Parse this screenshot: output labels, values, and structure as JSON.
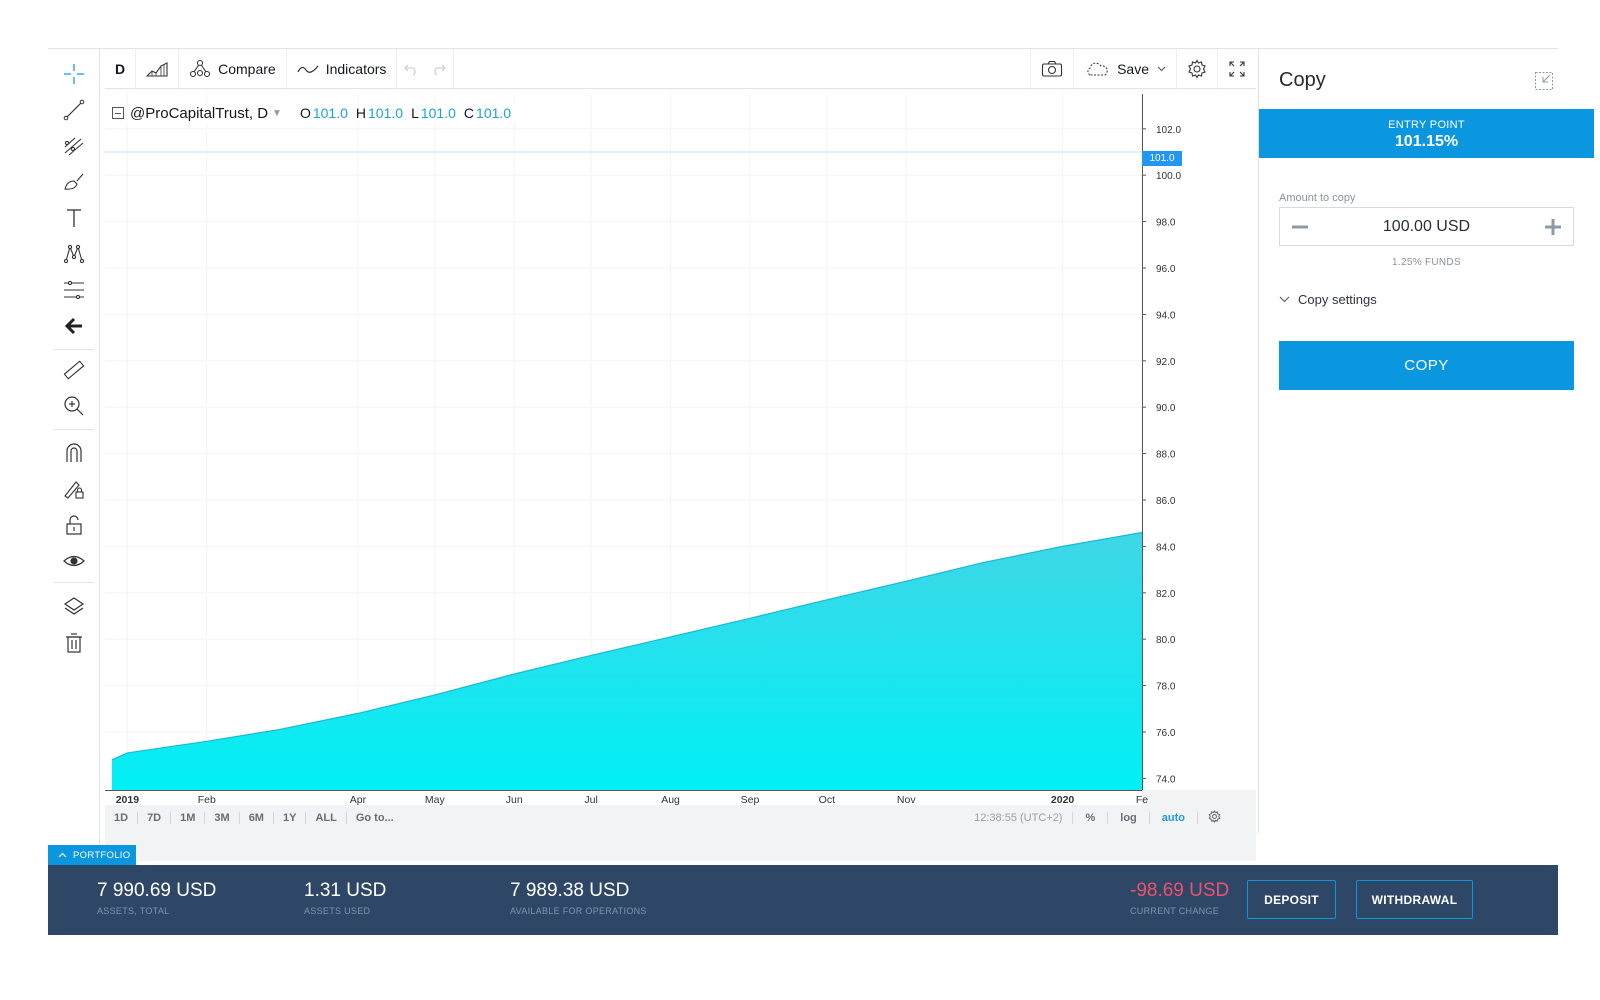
{
  "toolbar": {
    "interval": "D",
    "compare_label": "Compare",
    "indicators_label": "Indicators",
    "save_label": "Save"
  },
  "left_tools": [
    "crosshair-icon",
    "trend-line-icon",
    "pitchfork-icon",
    "brush-icon",
    "text-icon",
    "pattern-icon",
    "fib-icon",
    "back-arrow-icon",
    "ruler-icon",
    "zoom-in-icon",
    "magnet-icon",
    "lock-drawing-icon",
    "unlock-icon",
    "eye-icon",
    "layers-icon",
    "trash-icon"
  ],
  "legend": {
    "symbol": "@ProCapitalTrust, D",
    "o_label": "O",
    "o_value": "101.0",
    "h_label": "H",
    "h_value": "101.0",
    "l_label": "L",
    "l_value": "101.0",
    "c_label": "C",
    "c_value": "101.0"
  },
  "chart_data": {
    "type": "area",
    "x": [
      "2018-12-26",
      "2019-01-01",
      "2019-02-01",
      "2019-03-01",
      "2019-04-01",
      "2019-05-01",
      "2019-06-01",
      "2019-07-01",
      "2019-08-01",
      "2019-09-01",
      "2019-10-01",
      "2019-11-01",
      "2019-12-01",
      "2020-01-01",
      "2020-02-01"
    ],
    "series": [
      {
        "values": [
          74.8,
          75.1,
          75.6,
          76.1,
          76.8,
          77.6,
          78.5,
          79.3,
          80.1,
          80.9,
          81.7,
          82.5,
          83.3,
          84.0,
          84.6
        ]
      }
    ],
    "x_ticks": [
      "2019",
      "Feb",
      "Apr",
      "May",
      "Jun",
      "Jul",
      "Aug",
      "Sep",
      "Oct",
      "Nov",
      "2020",
      "Fe"
    ],
    "y_ticks": [
      "102.0",
      "100.0",
      "98.0",
      "96.0",
      "94.0",
      "92.0",
      "90.0",
      "88.0",
      "86.0",
      "84.0",
      "82.0",
      "80.0",
      "78.0",
      "76.0",
      "74.0"
    ],
    "ylim": [
      73.5,
      103.5
    ],
    "current_price": "101.0",
    "color": "#00f0f5",
    "line_color": "#1ab8d6",
    "grid": true
  },
  "range_bar": {
    "ranges": [
      "1D",
      "7D",
      "1M",
      "3M",
      "6M",
      "1Y",
      "ALL",
      "Go to..."
    ],
    "clock": "12:38:55 (UTC+2)",
    "percent": "%",
    "log": "log",
    "auto": "auto"
  },
  "panel": {
    "title": "Copy",
    "entry_label": "ENTRY POINT",
    "entry_value": "101.15%",
    "amount_label": "Amount to copy",
    "amount_value": "100.00 USD",
    "funds": "1.25% FUNDS",
    "settings_label": "Copy settings",
    "copy_button": "COPY"
  },
  "portfolio": {
    "tab_label": "PORTFOLIO",
    "assets_total_value": "7 990.69 USD",
    "assets_total_label": "ASSETS, TOTAL",
    "assets_used_value": "1.31 USD",
    "assets_used_label": "ASSETS USED",
    "available_value": "7 989.38 USD",
    "available_label": "AVAILABLE FOR OPERATIONS",
    "change_value": "-98.69 USD",
    "change_label": "CURRENT CHANGE",
    "deposit_label": "DEPOSIT",
    "withdrawal_label": "WITHDRAWAL"
  },
  "colors": {
    "accent": "#0b96e0",
    "area": "#00f0f5",
    "negative": "#f0506e",
    "bar_bg": "#2f4767"
  }
}
